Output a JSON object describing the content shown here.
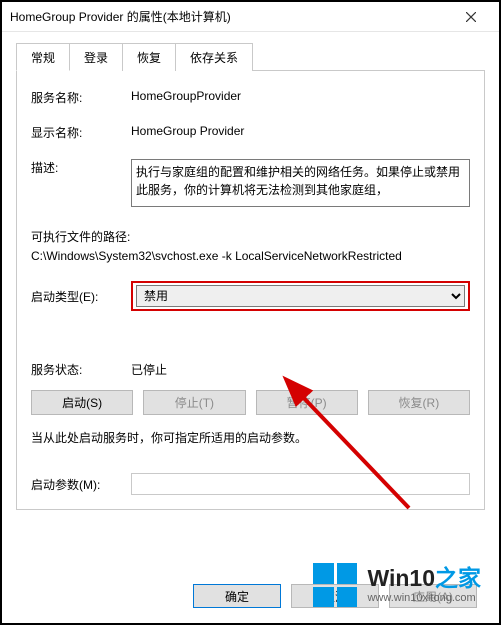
{
  "window": {
    "title": "HomeGroup Provider 的属性(本地计算机)"
  },
  "tabs": [
    {
      "label": "常规"
    },
    {
      "label": "登录"
    },
    {
      "label": "恢复"
    },
    {
      "label": "依存关系"
    }
  ],
  "labels": {
    "service_name": "服务名称:",
    "display_name": "显示名称:",
    "description": "描述:",
    "exe_path_label": "可执行文件的路径:",
    "startup_type": "启动类型(E):",
    "service_status": "服务状态:",
    "start_param": "启动参数(M):"
  },
  "fields": {
    "service_name_value": "HomeGroupProvider",
    "display_name_value": "HomeGroup Provider",
    "description_value": "执行与家庭组的配置和维护相关的网络任务。如果停止或禁用此服务，你的计算机将无法检测到其他家庭组，",
    "exe_path_value": "C:\\Windows\\System32\\svchost.exe -k LocalServiceNetworkRestricted",
    "startup_selected": "禁用",
    "status_value": "已停止",
    "start_param_value": ""
  },
  "buttons": {
    "start": "启动(S)",
    "stop": "停止(T)",
    "pause": "暂停(P)",
    "resume": "恢复(R)",
    "ok": "确定",
    "cancel": "取消",
    "apply": "应用(A)"
  },
  "hint": "当从此处启动服务时，你可指定所适用的启动参数。",
  "watermark": {
    "brand_a": "Win10",
    "brand_b": "之家",
    "url": "www.win10xitong.com"
  }
}
